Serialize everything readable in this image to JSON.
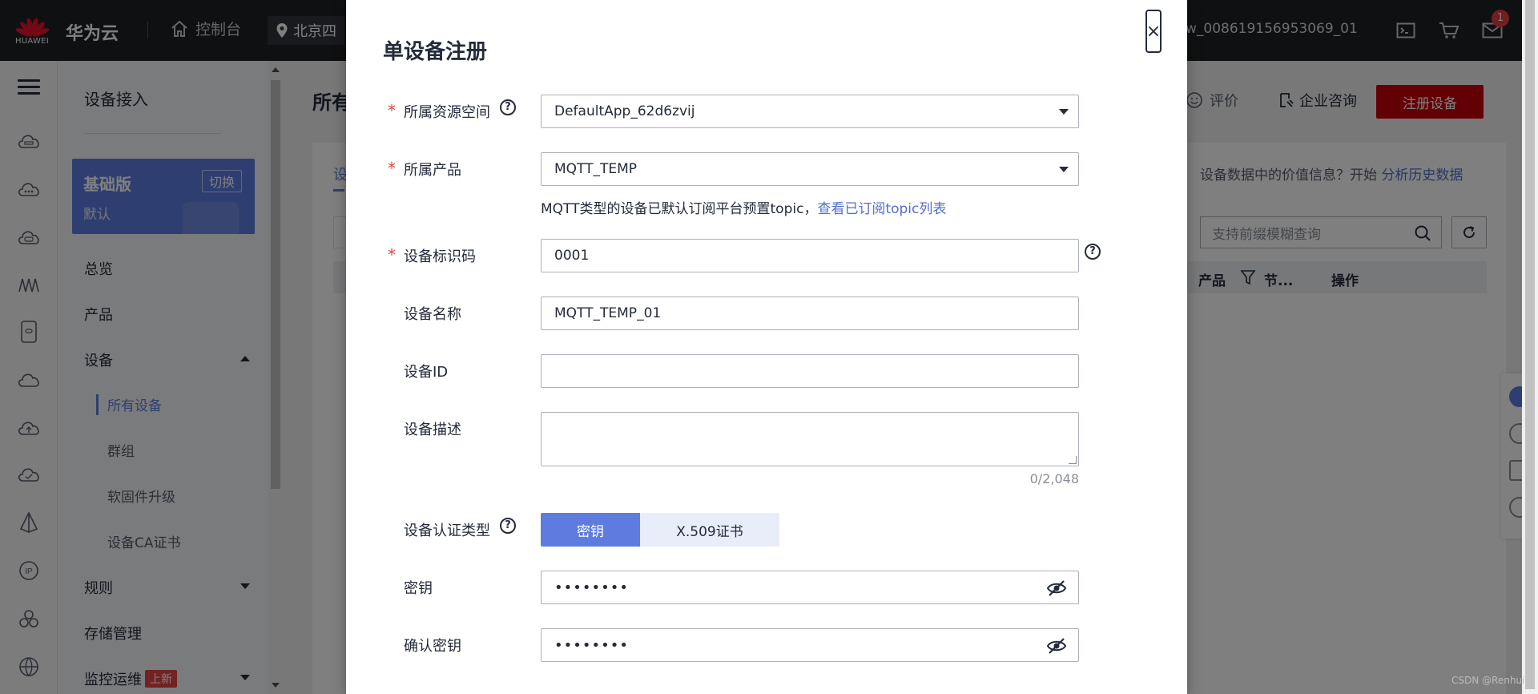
{
  "topbar": {
    "logo_text": "HUAWEI",
    "brand": "华为云",
    "console": "控制台",
    "region": "北京四",
    "account": "w_008619156953069_01",
    "notification_count": "1"
  },
  "subnav": {
    "title": "设备接入",
    "edition": {
      "name": "基础版",
      "sub": "默认",
      "switch_label": "切换"
    },
    "items": {
      "overview": "总览",
      "product": "产品",
      "device": "设备",
      "all_devices": "所有设备",
      "group": "群组",
      "firmware": "软固件升级",
      "ca_cert": "设备CA证书",
      "rules": "规则",
      "storage": "存储管理",
      "monitoring": "监控运维",
      "new_tag": "上新"
    }
  },
  "main": {
    "title_fragment": "所有",
    "rate": "评价",
    "consult": "企业咨询",
    "register_button": "注册设备",
    "tab_fragment": "设",
    "hint_text": "设备数据中的价值信息？开始",
    "hint_link": "分析历史数据",
    "search_placeholder": "支持前缀模糊查询",
    "table_headers": {
      "product": "产品",
      "node": "节...",
      "actions": "操作"
    }
  },
  "modal": {
    "title": "单设备注册",
    "close_label": "×",
    "resource_space_label": "所属资源空间",
    "resource_space_value": "DefaultApp_62d6zvij",
    "product_label": "所属产品",
    "product_value": "MQTT_TEMP",
    "topic_note": "MQTT类型的设备已默认订阅平台预置topic，",
    "topic_link": "查看已订阅topic列表",
    "identifier_label": "设备标识码",
    "identifier_value": "0001",
    "name_label": "设备名称",
    "name_value": "MQTT_TEMP_01",
    "id_label": "设备ID",
    "id_value": "",
    "desc_label": "设备描述",
    "desc_counter": "0/2,048",
    "auth_type_label": "设备认证类型",
    "auth_options": [
      "密钥",
      "X.509证书"
    ],
    "secret_label": "密钥",
    "secret_value": "••••••••",
    "confirm_label": "确认密钥",
    "confirm_value": "••••••••"
  },
  "watermark": "CSDN @Renhui",
  "colors": {
    "accent": "#5e7ce0",
    "brand_red": "#c7000b",
    "topbar_bg": "#1f2022",
    "required": "#e54545"
  }
}
